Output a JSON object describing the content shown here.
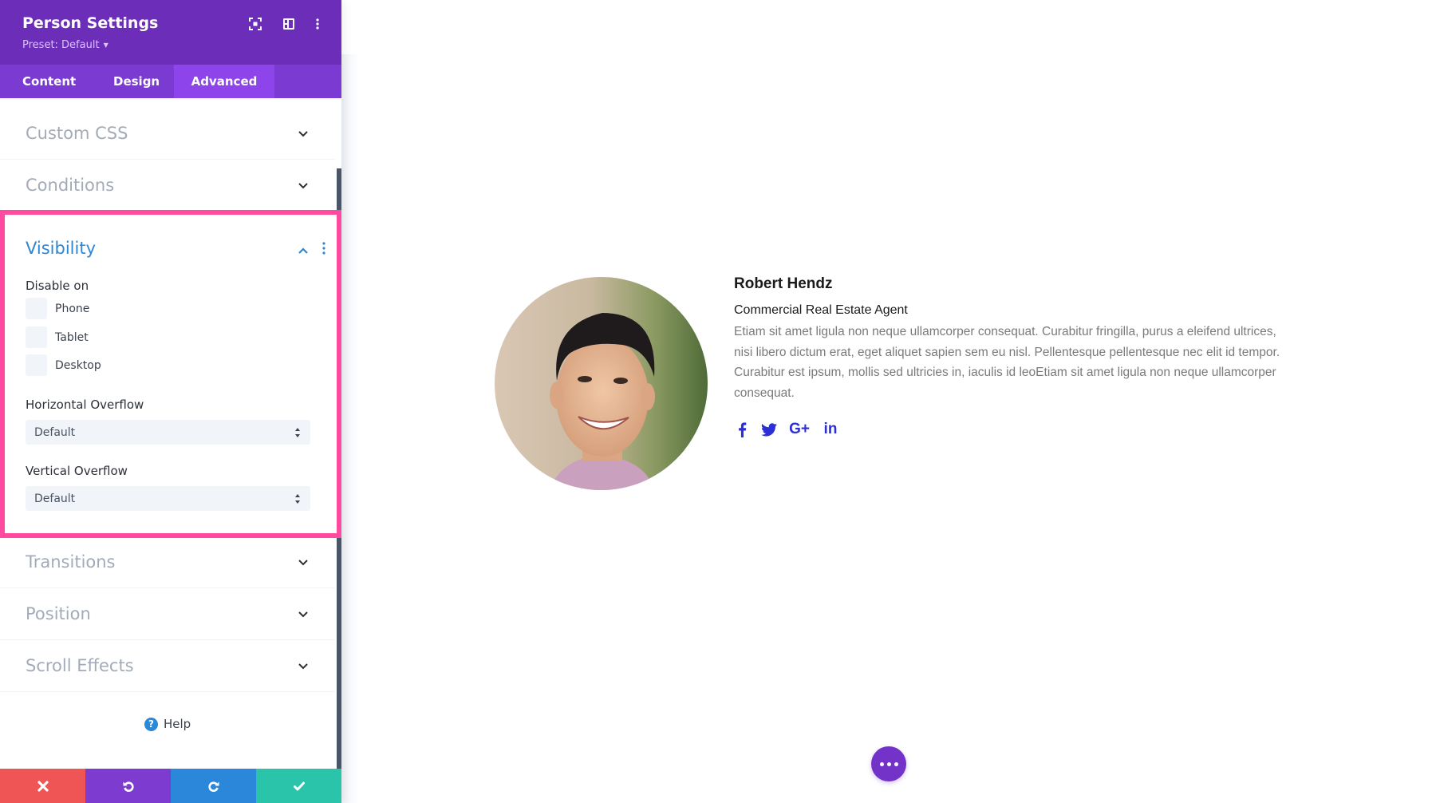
{
  "panel": {
    "title": "Person Settings",
    "preset": "Preset: Default",
    "header_icons": [
      "expand-icon",
      "split-view-icon",
      "more-options-icon"
    ],
    "tabs": [
      {
        "label": "Content",
        "active": false
      },
      {
        "label": "Design",
        "active": false
      },
      {
        "label": "Advanced",
        "active": true
      }
    ],
    "sections_above": [
      {
        "label": "Custom CSS",
        "expanded": false
      },
      {
        "label": "Conditions",
        "expanded": false
      }
    ],
    "visibility": {
      "title": "Visibility",
      "expanded": true,
      "disable_on_label": "Disable on",
      "checkboxes": [
        {
          "label": "Phone",
          "checked": false
        },
        {
          "label": "Tablet",
          "checked": false
        },
        {
          "label": "Desktop",
          "checked": false
        }
      ],
      "horizontal_overflow": {
        "label": "Horizontal Overflow",
        "value": "Default"
      },
      "vertical_overflow": {
        "label": "Vertical Overflow",
        "value": "Default"
      }
    },
    "sections_below": [
      {
        "label": "Transitions",
        "expanded": false
      },
      {
        "label": "Position",
        "expanded": false
      },
      {
        "label": "Scroll Effects",
        "expanded": false
      }
    ],
    "help_label": "Help",
    "footer_buttons": [
      {
        "name": "discard",
        "icon": "close-icon",
        "color": "#ef5555"
      },
      {
        "name": "undo",
        "icon": "undo-icon",
        "color": "#7e3bd0"
      },
      {
        "name": "redo",
        "icon": "redo-icon",
        "color": "#2b87da"
      },
      {
        "name": "save",
        "icon": "check-icon",
        "color": "#29c4a9"
      }
    ]
  },
  "person": {
    "name": "Robert Hendz",
    "role": "Commercial Real Estate Agent",
    "bio": "Etiam sit amet ligula non neque ullamcorper consequat. Curabitur fringilla, purus a eleifend ultrices, nisi libero dictum erat, eget aliquet sapien sem eu nisl. Pellentesque pellentesque nec elit id tempor. Curabitur est ipsum, mollis sed ultricies in, iaculis id leoEtiam sit amet ligula non neque ullamcorper consequat.",
    "social": [
      {
        "network": "facebook",
        "glyph": "f"
      },
      {
        "network": "twitter",
        "glyph": "t"
      },
      {
        "network": "google-plus",
        "glyph": "G+"
      },
      {
        "network": "linkedin",
        "glyph": "in"
      }
    ]
  },
  "colors": {
    "header": "#6c2eb9",
    "tabs_bar": "#7b3bd3",
    "active_tab": "#8d44ea",
    "highlight_border": "#ff4aa0",
    "section_active_title": "#2d86d3",
    "social_icons": "#2c2fd6",
    "fab": "#7433c8"
  }
}
